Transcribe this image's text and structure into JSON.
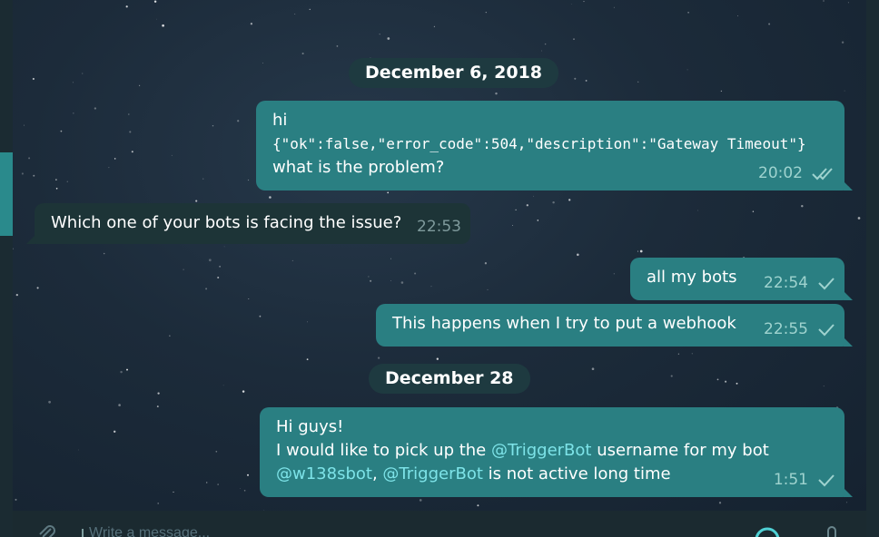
{
  "dates": [
    {
      "label": "December 6, 2018"
    },
    {
      "label": "December 28"
    }
  ],
  "messages": [
    {
      "direction": "out",
      "line1": "hi",
      "line2": "{\"ok\":false,\"error_code\":504,\"description\":\"Gateway Timeout\"}",
      "line3": "what is the problem?",
      "time": "20:02",
      "status": "read"
    },
    {
      "direction": "in",
      "text": "Which one of your bots is facing the issue?",
      "time": "22:53"
    },
    {
      "direction": "out",
      "text": "all my bots",
      "time": "22:54",
      "status": "sent"
    },
    {
      "direction": "out",
      "text": "This happens when I try to put a webhook",
      "time": "22:55",
      "status": "sent"
    },
    {
      "direction": "out",
      "line1": "Hi guys!",
      "line2_prefix": "I would like to pick up the ",
      "mention1": "@TriggerBot",
      "line2_suffix": " username for my bot",
      "mention2": "@w138sbot",
      "sep": ", ",
      "mention3": "@TriggerBot",
      "line3_suffix": " is not active long time",
      "time": "1:51",
      "status": "sent"
    }
  ],
  "composer": {
    "placeholder": "Write a message..."
  },
  "icons": {
    "attach": "paperclip-icon",
    "emoji": "emoji-icon",
    "mic": "microphone-icon",
    "sent": "single-check-icon",
    "read": "double-check-icon"
  },
  "colors": {
    "outgoing_bubble": "#2a7f82",
    "incoming_bubble": "#1d3437",
    "date_pill": "#1e3a40",
    "mention": "#7de3e8",
    "meta": "#9fd3cf"
  }
}
